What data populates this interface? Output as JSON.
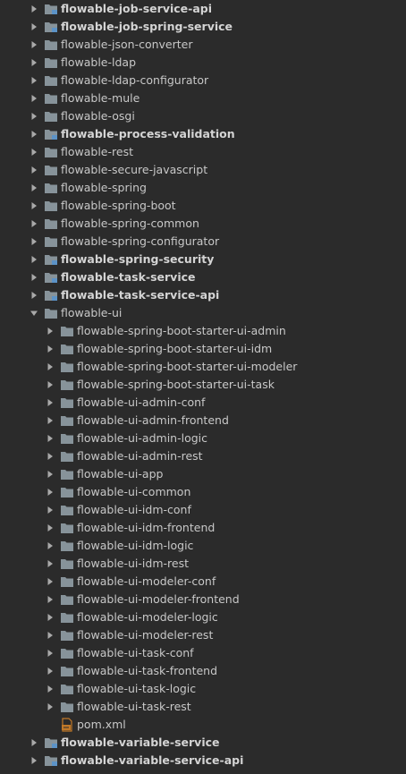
{
  "tree": {
    "nodes": [
      {
        "label": "flowable-job-service-api",
        "depth": 0,
        "expanded": false,
        "bold": true,
        "kind": "module-folder-icon"
      },
      {
        "label": "flowable-job-spring-service",
        "depth": 0,
        "expanded": false,
        "bold": true,
        "kind": "module-folder-icon"
      },
      {
        "label": "flowable-json-converter",
        "depth": 0,
        "expanded": false,
        "bold": false,
        "kind": "folder-icon"
      },
      {
        "label": "flowable-ldap",
        "depth": 0,
        "expanded": false,
        "bold": false,
        "kind": "folder-icon"
      },
      {
        "label": "flowable-ldap-configurator",
        "depth": 0,
        "expanded": false,
        "bold": false,
        "kind": "folder-icon"
      },
      {
        "label": "flowable-mule",
        "depth": 0,
        "expanded": false,
        "bold": false,
        "kind": "folder-icon"
      },
      {
        "label": "flowable-osgi",
        "depth": 0,
        "expanded": false,
        "bold": false,
        "kind": "folder-icon"
      },
      {
        "label": "flowable-process-validation",
        "depth": 0,
        "expanded": false,
        "bold": true,
        "kind": "module-folder-icon"
      },
      {
        "label": "flowable-rest",
        "depth": 0,
        "expanded": false,
        "bold": false,
        "kind": "folder-icon"
      },
      {
        "label": "flowable-secure-javascript",
        "depth": 0,
        "expanded": false,
        "bold": false,
        "kind": "folder-icon"
      },
      {
        "label": "flowable-spring",
        "depth": 0,
        "expanded": false,
        "bold": false,
        "kind": "folder-icon"
      },
      {
        "label": "flowable-spring-boot",
        "depth": 0,
        "expanded": false,
        "bold": false,
        "kind": "folder-icon"
      },
      {
        "label": "flowable-spring-common",
        "depth": 0,
        "expanded": false,
        "bold": false,
        "kind": "folder-icon"
      },
      {
        "label": "flowable-spring-configurator",
        "depth": 0,
        "expanded": false,
        "bold": false,
        "kind": "folder-icon"
      },
      {
        "label": "flowable-spring-security",
        "depth": 0,
        "expanded": false,
        "bold": true,
        "kind": "module-folder-icon"
      },
      {
        "label": "flowable-task-service",
        "depth": 0,
        "expanded": false,
        "bold": true,
        "kind": "module-folder-icon"
      },
      {
        "label": "flowable-task-service-api",
        "depth": 0,
        "expanded": false,
        "bold": true,
        "kind": "module-folder-icon"
      },
      {
        "label": "flowable-ui",
        "depth": 0,
        "expanded": true,
        "bold": false,
        "kind": "folder-icon"
      },
      {
        "label": "flowable-spring-boot-starter-ui-admin",
        "depth": 1,
        "expanded": false,
        "bold": false,
        "kind": "folder-icon"
      },
      {
        "label": "flowable-spring-boot-starter-ui-idm",
        "depth": 1,
        "expanded": false,
        "bold": false,
        "kind": "folder-icon"
      },
      {
        "label": "flowable-spring-boot-starter-ui-modeler",
        "depth": 1,
        "expanded": false,
        "bold": false,
        "kind": "folder-icon"
      },
      {
        "label": "flowable-spring-boot-starter-ui-task",
        "depth": 1,
        "expanded": false,
        "bold": false,
        "kind": "folder-icon"
      },
      {
        "label": "flowable-ui-admin-conf",
        "depth": 1,
        "expanded": false,
        "bold": false,
        "kind": "folder-icon"
      },
      {
        "label": "flowable-ui-admin-frontend",
        "depth": 1,
        "expanded": false,
        "bold": false,
        "kind": "folder-icon"
      },
      {
        "label": "flowable-ui-admin-logic",
        "depth": 1,
        "expanded": false,
        "bold": false,
        "kind": "folder-icon"
      },
      {
        "label": "flowable-ui-admin-rest",
        "depth": 1,
        "expanded": false,
        "bold": false,
        "kind": "folder-icon"
      },
      {
        "label": "flowable-ui-app",
        "depth": 1,
        "expanded": false,
        "bold": false,
        "kind": "folder-icon"
      },
      {
        "label": "flowable-ui-common",
        "depth": 1,
        "expanded": false,
        "bold": false,
        "kind": "folder-icon"
      },
      {
        "label": "flowable-ui-idm-conf",
        "depth": 1,
        "expanded": false,
        "bold": false,
        "kind": "folder-icon"
      },
      {
        "label": "flowable-ui-idm-frontend",
        "depth": 1,
        "expanded": false,
        "bold": false,
        "kind": "folder-icon"
      },
      {
        "label": "flowable-ui-idm-logic",
        "depth": 1,
        "expanded": false,
        "bold": false,
        "kind": "folder-icon"
      },
      {
        "label": "flowable-ui-idm-rest",
        "depth": 1,
        "expanded": false,
        "bold": false,
        "kind": "folder-icon"
      },
      {
        "label": "flowable-ui-modeler-conf",
        "depth": 1,
        "expanded": false,
        "bold": false,
        "kind": "folder-icon"
      },
      {
        "label": "flowable-ui-modeler-frontend",
        "depth": 1,
        "expanded": false,
        "bold": false,
        "kind": "folder-icon"
      },
      {
        "label": "flowable-ui-modeler-logic",
        "depth": 1,
        "expanded": false,
        "bold": false,
        "kind": "folder-icon"
      },
      {
        "label": "flowable-ui-modeler-rest",
        "depth": 1,
        "expanded": false,
        "bold": false,
        "kind": "folder-icon"
      },
      {
        "label": "flowable-ui-task-conf",
        "depth": 1,
        "expanded": false,
        "bold": false,
        "kind": "folder-icon"
      },
      {
        "label": "flowable-ui-task-frontend",
        "depth": 1,
        "expanded": false,
        "bold": false,
        "kind": "folder-icon"
      },
      {
        "label": "flowable-ui-task-logic",
        "depth": 1,
        "expanded": false,
        "bold": false,
        "kind": "folder-icon"
      },
      {
        "label": "flowable-ui-task-rest",
        "depth": 1,
        "expanded": false,
        "bold": false,
        "kind": "folder-icon"
      },
      {
        "label": "pom.xml",
        "depth": 1,
        "expanded": null,
        "bold": false,
        "kind": "maven-pom-file-icon"
      },
      {
        "label": "flowable-variable-service",
        "depth": 0,
        "expanded": false,
        "bold": true,
        "kind": "module-folder-icon"
      },
      {
        "label": "flowable-variable-service-api",
        "depth": 0,
        "expanded": false,
        "bold": true,
        "kind": "module-folder-icon"
      }
    ]
  },
  "colors": {
    "background": "#2b2b2b",
    "text": "#c8c8c8",
    "arrow": "#a9a9a9",
    "folder": "#87939a",
    "module_marker": "#5c93c7",
    "pom_icon": "#c07828"
  }
}
